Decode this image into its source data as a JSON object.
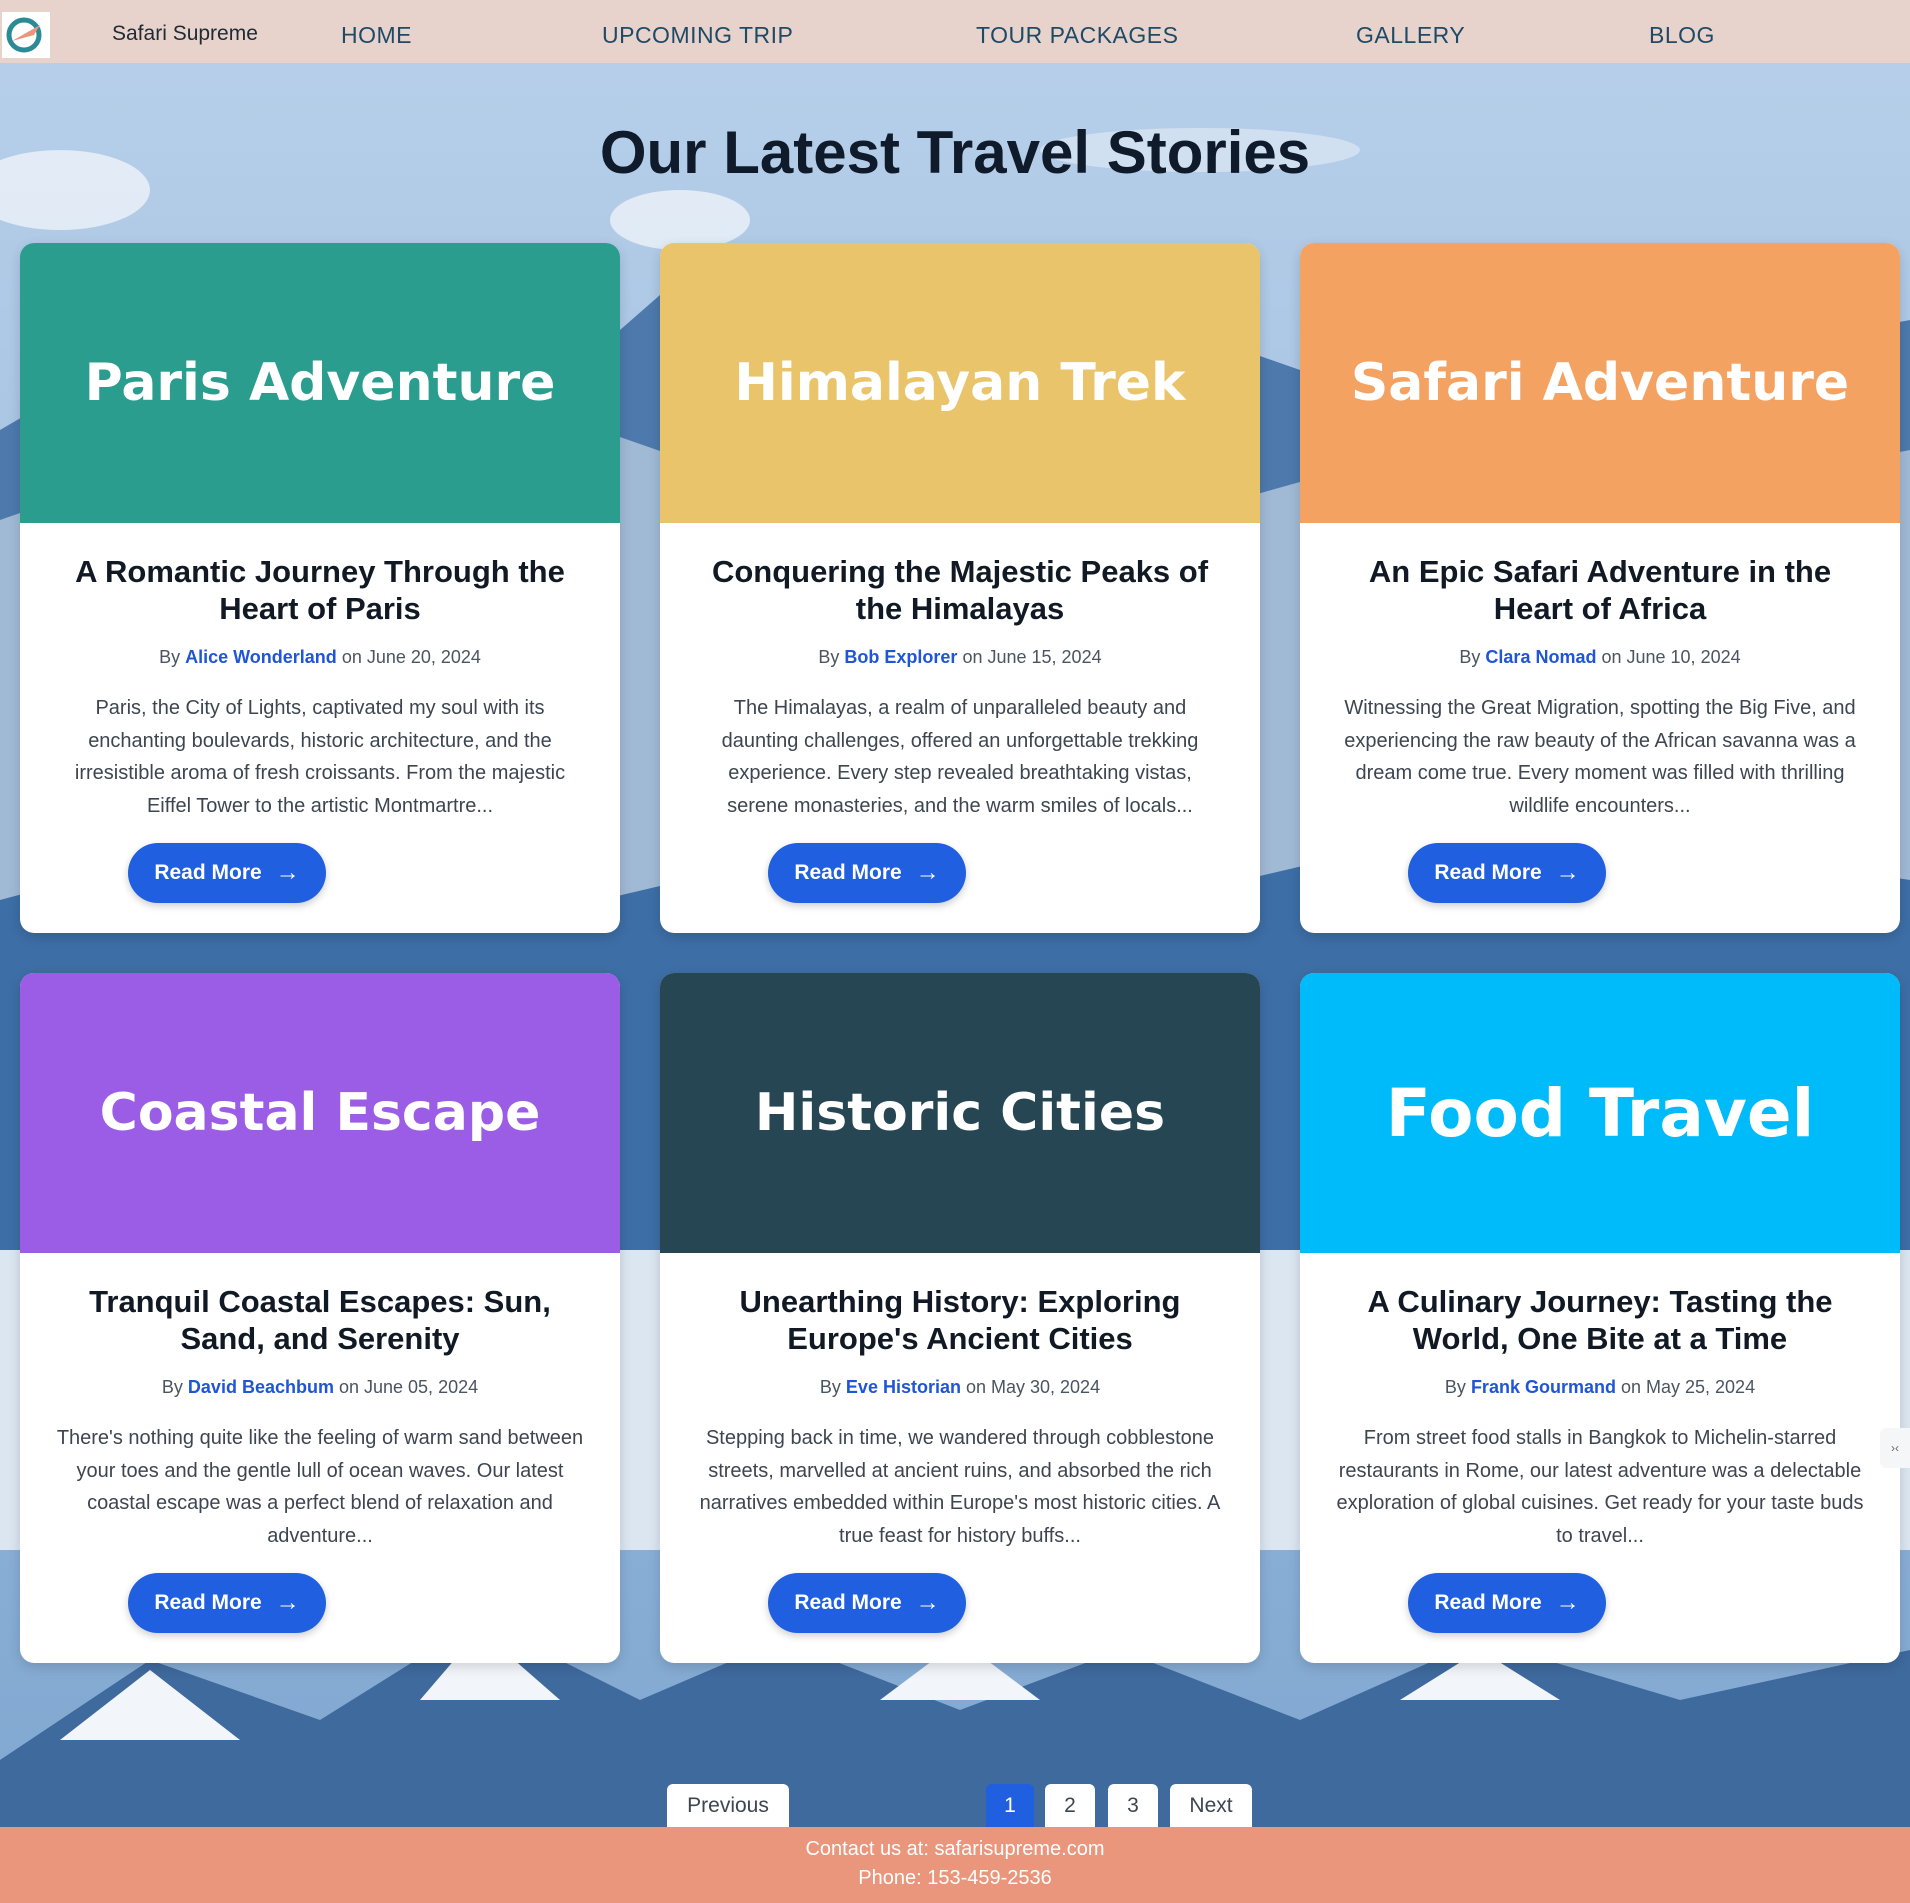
{
  "header": {
    "brand": "Safari Supreme",
    "nav": [
      "HOME",
      "UPCOMING TRIP",
      "TOUR PACKAGES",
      "GALLERY",
      "BLOG"
    ]
  },
  "page_title": "Our Latest Travel Stories",
  "cards": [
    {
      "banner": "Paris Adventure",
      "banner_color": "#2a9d8f",
      "title": "A Romantic Journey Through the Heart of Paris",
      "by": "By",
      "author": "Alice Wonderland",
      "date_text": "on June 20, 2024",
      "excerpt": "Paris, the City of Lights, captivated my soul with its enchanting boulevards, historic architecture, and the irresistible aroma of fresh croissants. From the majestic Eiffel Tower to the artistic Montmartre...",
      "button": "Read More"
    },
    {
      "banner": "Himalayan Trek",
      "banner_color": "#e9c46a",
      "title": "Conquering the Majestic Peaks of the Himalayas",
      "by": "By",
      "author": "Bob Explorer",
      "date_text": "on June 15, 2024",
      "excerpt": "The Himalayas, a realm of unparalleled beauty and daunting challenges, offered an unforgettable trekking experience. Every step revealed breathtaking vistas, serene monasteries, and the warm smiles of locals...",
      "button": "Read More"
    },
    {
      "banner": "Safari Adventure",
      "banner_color": "#f4a261",
      "title": "An Epic Safari Adventure in the Heart of Africa",
      "by": "By",
      "author": "Clara Nomad",
      "date_text": "on June 10, 2024",
      "excerpt": "Witnessing the Great Migration, spotting the Big Five, and experiencing the raw beauty of the African savanna was a dream come true. Every moment was filled with thrilling wildlife encounters...",
      "button": "Read More"
    },
    {
      "banner": "Coastal Escape",
      "banner_color": "#9b5de5",
      "title": "Tranquil Coastal Escapes: Sun, Sand, and Serenity",
      "by": "By",
      "author": "David Beachbum",
      "date_text": "on June 05, 2024",
      "excerpt": "There's nothing quite like the feeling of warm sand between your toes and the gentle lull of ocean waves. Our latest coastal escape was a perfect blend of relaxation and adventure...",
      "button": "Read More"
    },
    {
      "banner": "Historic Cities",
      "banner_color": "#264653",
      "title": "Unearthing History: Exploring Europe's Ancient Cities",
      "by": "By",
      "author": "Eve Historian",
      "date_text": "on May 30, 2024",
      "excerpt": "Stepping back in time, we wandered through cobblestone streets, marvelled at ancient ruins, and absorbed the rich narratives embedded within Europe's most historic cities. A true feast for history buffs...",
      "button": "Read More"
    },
    {
      "banner": "Food Travel",
      "banner_color": "#00bbf9",
      "title": "A Culinary Journey: Tasting the World, One Bite at a Time",
      "by": "By",
      "author": "Frank Gourmand",
      "date_text": "on May 25, 2024",
      "excerpt": "From street food stalls in Bangkok to Michelin-starred restaurants in Rome, our latest adventure was a delectable exploration of global cuisines. Get ready for your taste buds to travel...",
      "button": "Read More"
    }
  ],
  "pagination": {
    "previous": "Previous",
    "pages": [
      "1",
      "2",
      "3"
    ],
    "current": "1",
    "next": "Next"
  },
  "footer": {
    "contact": "Contact us at: safarisupreme.com",
    "phone": "Phone: 153-459-2536"
  },
  "colors": {
    "header_bg": "#e8d3cc",
    "accent_blue": "#1f5fe0",
    "footer_bg": "#e9967c"
  }
}
